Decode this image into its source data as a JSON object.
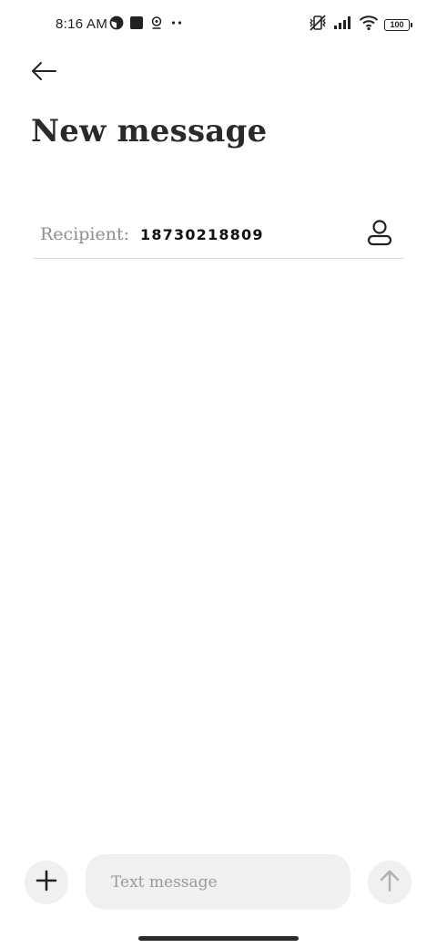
{
  "status_bar": {
    "time": "8:16 AM",
    "left_icons": [
      "data-saver-icon",
      "app-square-icon",
      "location-pin-icon",
      "more-dots-icon"
    ],
    "right_icons": [
      "vibrate-off-icon",
      "signal-icon",
      "wifi-icon"
    ],
    "battery_level": "100"
  },
  "header": {
    "back_icon": "arrow-left-icon",
    "title": "New message"
  },
  "recipient": {
    "label": "Recipient:",
    "value": "18730218809",
    "contact_icon": "person-icon"
  },
  "composer": {
    "attach_icon": "plus-icon",
    "placeholder": "Text message",
    "value": "",
    "send_icon": "arrow-up-icon"
  },
  "colors": {
    "background": "#ffffff",
    "text": "#222222",
    "muted_text": "#8e8e8e",
    "control_bg": "#f0f0f0",
    "divider": "#dcdcdc"
  }
}
